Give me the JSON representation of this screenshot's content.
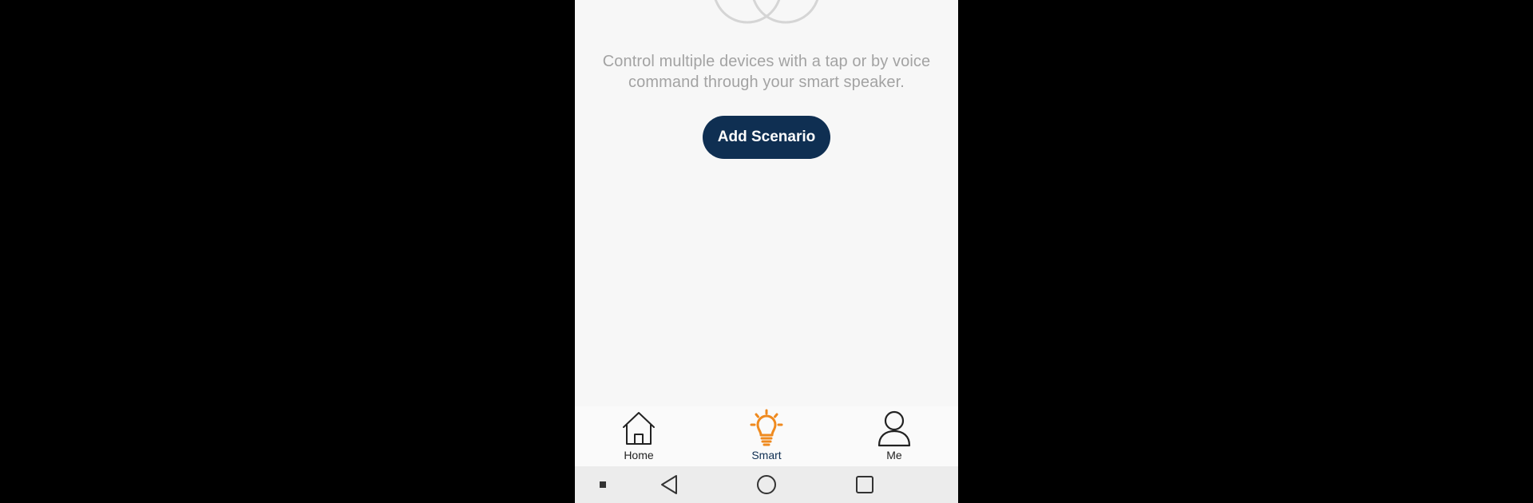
{
  "empty_state": {
    "message_line1": "Control multiple devices with a tap or by voice",
    "message_line2": "command through your smart speaker.",
    "button_label": "Add Scenario"
  },
  "tabs": [
    {
      "label": "Home",
      "icon": "home-icon",
      "active": false
    },
    {
      "label": "Smart",
      "icon": "lightbulb-icon",
      "active": true
    },
    {
      "label": "Me",
      "icon": "person-icon",
      "active": false
    }
  ],
  "system_nav": {
    "buttons": [
      "menu",
      "back",
      "home",
      "recents"
    ]
  },
  "colors": {
    "primary": "#0f2f52",
    "accent": "#ef8a1f",
    "background": "#f7f7f7",
    "text_muted": "#a3a3a3"
  }
}
